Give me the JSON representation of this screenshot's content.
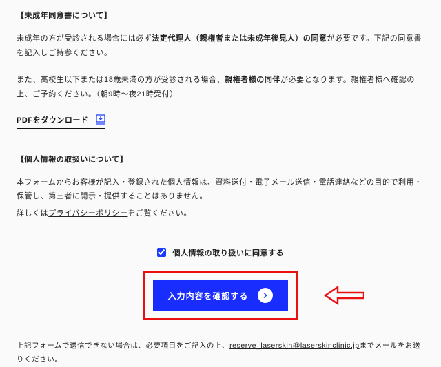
{
  "minor": {
    "title": "【未成年同意書について】",
    "para1_a": "未成年の方が受診される場合には必ず",
    "para1_b": "法定代理人（親権者または未成年後見人）の同意",
    "para1_c": "が必要です。下記の同意書を記入しご持参ください。",
    "para2_a": "また、高校生以下または18歳未満の方が受診される場合、",
    "para2_b": "親権者様の同伴",
    "para2_c": "が必要となります。親権者様へ確認の上、ご予約ください。（朝9時～夜21時受付）",
    "download": "PDFをダウンロード"
  },
  "privacy": {
    "title": "【個人情報の取扱いについて】",
    "p1": "本フォームからお客様が記入・登録された個人情報は、資料送付・電子メール送信・電話連絡などの目的で利用・保管し、第三者に開示・提供することはありません。",
    "p2a": "詳しくは",
    "p2link": "プライバシーポリシー",
    "p2b": "をご覧ください。"
  },
  "consent": {
    "label": "個人情報の取り扱いに同意する"
  },
  "button": {
    "label": "入力内容を確認する"
  },
  "footer": {
    "a": "上記フォームで送信できない場合は、必要項目をご記入の上、",
    "email": "reserve_laserskin@laserskinclinic.jp",
    "b": "までメールをお送りください。"
  }
}
